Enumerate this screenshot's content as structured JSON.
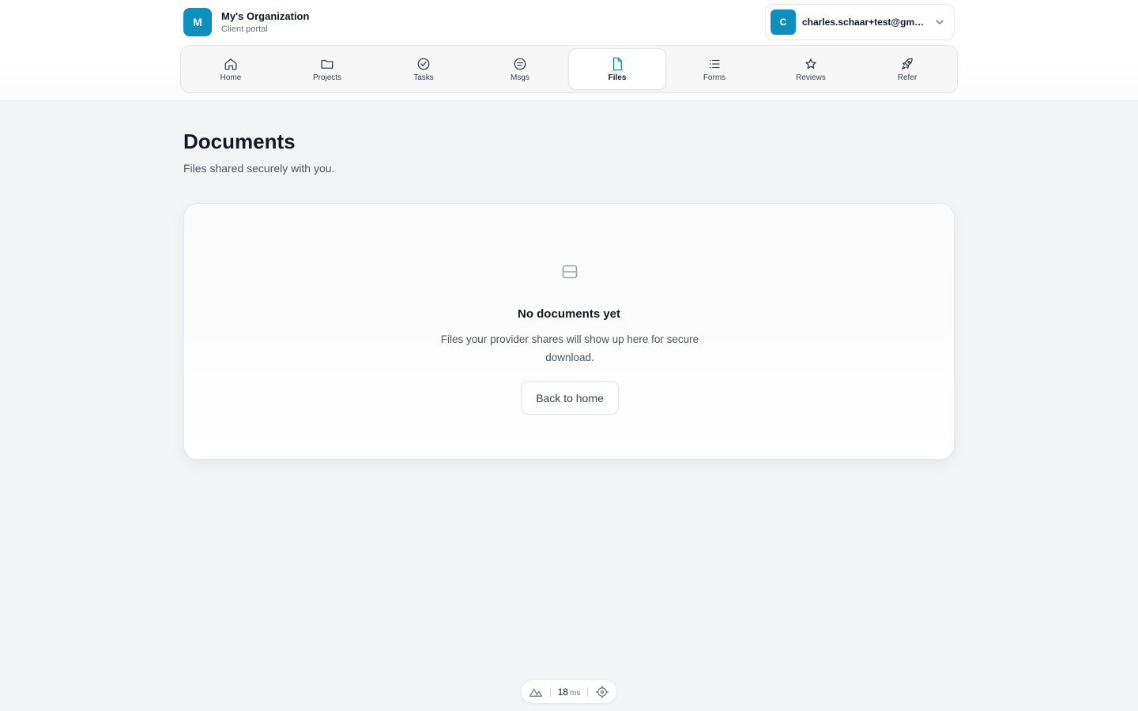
{
  "org": {
    "initial": "M",
    "name": "My's Organization",
    "subtitle": "Client portal"
  },
  "user": {
    "initial": "C",
    "email": "charles.schaar+test@gmail.com"
  },
  "nav": {
    "items": [
      {
        "label": "Home",
        "icon": "home-icon"
      },
      {
        "label": "Projects",
        "icon": "folder-icon"
      },
      {
        "label": "Tasks",
        "icon": "check-circle-icon"
      },
      {
        "label": "Msgs",
        "icon": "message-icon"
      },
      {
        "label": "Files",
        "icon": "file-icon",
        "active": true
      },
      {
        "label": "Forms",
        "icon": "list-icon"
      },
      {
        "label": "Reviews",
        "icon": "star-icon"
      },
      {
        "label": "Refer",
        "icon": "rocket-icon"
      }
    ]
  },
  "page": {
    "title": "Documents",
    "subtitle": "Files shared securely with you."
  },
  "empty": {
    "icon": "document-placeholder-icon",
    "title": "No documents yet",
    "description": "Files your provider shares will show up here for secure download.",
    "button_label": "Back to home"
  },
  "devbar": {
    "timing_value": "18",
    "timing_unit": "ms"
  },
  "colors": {
    "accent": "#0f8fbd",
    "background": "#f3f4f5"
  }
}
